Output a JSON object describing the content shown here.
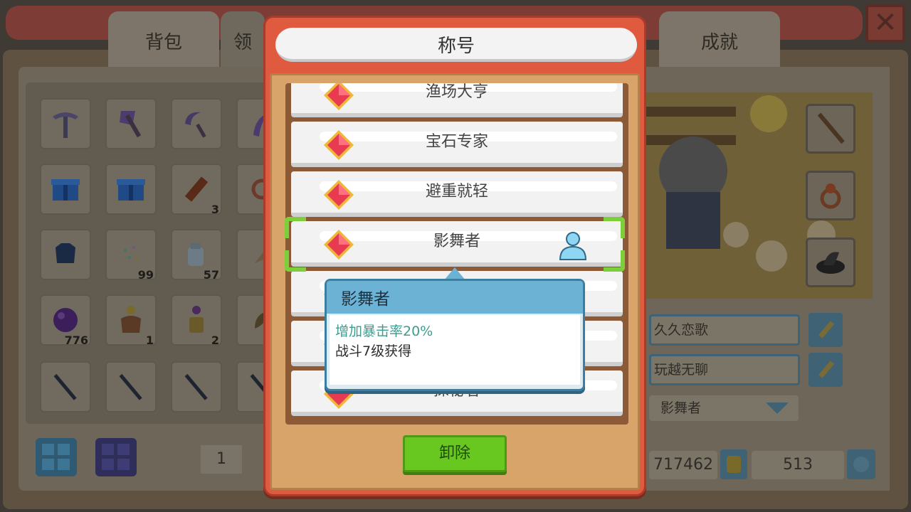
{
  "background": {
    "tabs": [
      "背包",
      "领",
      "成就"
    ],
    "inventory": [
      {
        "icon": "pickaxe-icon",
        "count": ""
      },
      {
        "icon": "axe-icon",
        "count": ""
      },
      {
        "icon": "sickle-icon",
        "count": ""
      },
      {
        "icon": "scythe-icon",
        "count": ""
      },
      {
        "icon": "gift-box-icon",
        "count": ""
      },
      {
        "icon": "gift-box-icon",
        "count": ""
      },
      {
        "icon": "firecracker-icon",
        "count": "3"
      },
      {
        "icon": "ring-icon",
        "count": ""
      },
      {
        "icon": "armor-icon",
        "count": ""
      },
      {
        "icon": "seeds-icon",
        "count": "99"
      },
      {
        "icon": "milk-jug-icon",
        "count": "57"
      },
      {
        "icon": "feather-icon",
        "count": ""
      },
      {
        "icon": "crystal-orb-icon",
        "count": "776"
      },
      {
        "icon": "flower-bag-icon",
        "count": "1"
      },
      {
        "icon": "potion-bottle-icon",
        "count": "2"
      },
      {
        "icon": "leaf-icon",
        "count": ""
      },
      {
        "icon": "fishing-rod-icon",
        "count": ""
      },
      {
        "icon": "fishing-rod-icon",
        "count": ""
      },
      {
        "icon": "fishing-rod-icon",
        "count": ""
      },
      {
        "icon": "fishing-rod-icon",
        "count": ""
      }
    ],
    "page_number": "1",
    "profile": {
      "name_field_1": "久久恋歌",
      "name_field_2": "玩越无聊",
      "title_selected": "影舞者",
      "gold": "717462",
      "gems": "513"
    }
  },
  "modal": {
    "title": "称号",
    "titles": [
      {
        "label": "渔场大亨"
      },
      {
        "label": "宝石专家"
      },
      {
        "label": "避重就轻"
      },
      {
        "label": "影舞者",
        "selected": true,
        "equipped": true
      },
      {
        "label": ""
      },
      {
        "label": ""
      },
      {
        "label": "探秘者"
      }
    ],
    "tooltip": {
      "name": "影舞者",
      "effect": "增加暴击率20%",
      "source": "战斗7级获得"
    },
    "unequip_label": "卸除"
  },
  "colors": {
    "modal_border": "#e05a40",
    "selection": "#7dcf3a",
    "tooltip_header": "#6cb2d4",
    "effect_text": "#3b9c8f",
    "unequip_button": "#69c820"
  }
}
